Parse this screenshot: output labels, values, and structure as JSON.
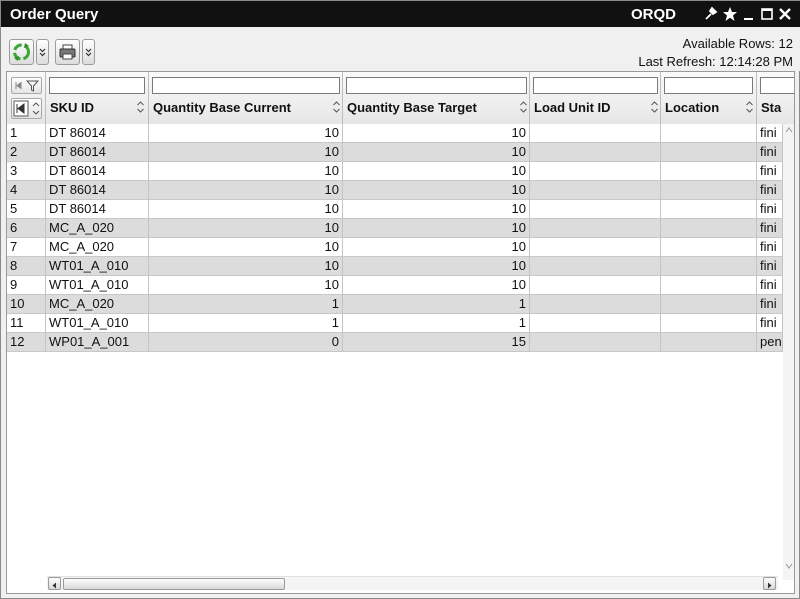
{
  "window": {
    "title": "Order Query",
    "code": "ORQD"
  },
  "status": {
    "available_rows": "Available Rows: 12",
    "last_refresh": "Last Refresh: 12:14:28 PM"
  },
  "columns": [
    {
      "key": "rownum",
      "label": ""
    },
    {
      "key": "sku",
      "label": "SKU ID"
    },
    {
      "key": "qbc",
      "label": "Quantity Base Current"
    },
    {
      "key": "qbt",
      "label": "Quantity Base Target"
    },
    {
      "key": "lu",
      "label": "Load Unit ID"
    },
    {
      "key": "loc",
      "label": "Location"
    },
    {
      "key": "status",
      "label": "Sta"
    }
  ],
  "rows": [
    {
      "n": "1",
      "sku": "DT 86014",
      "qbc": "10",
      "qbt": "10",
      "lu": "",
      "loc": "",
      "status": "fini"
    },
    {
      "n": "2",
      "sku": "DT 86014",
      "qbc": "10",
      "qbt": "10",
      "lu": "",
      "loc": "",
      "status": "fini"
    },
    {
      "n": "3",
      "sku": "DT 86014",
      "qbc": "10",
      "qbt": "10",
      "lu": "",
      "loc": "",
      "status": "fini"
    },
    {
      "n": "4",
      "sku": "DT 86014",
      "qbc": "10",
      "qbt": "10",
      "lu": "",
      "loc": "",
      "status": "fini"
    },
    {
      "n": "5",
      "sku": "DT 86014",
      "qbc": "10",
      "qbt": "10",
      "lu": "",
      "loc": "",
      "status": "fini"
    },
    {
      "n": "6",
      "sku": "MC_A_020",
      "qbc": "10",
      "qbt": "10",
      "lu": "",
      "loc": "",
      "status": "fini"
    },
    {
      "n": "7",
      "sku": "MC_A_020",
      "qbc": "10",
      "qbt": "10",
      "lu": "",
      "loc": "",
      "status": "fini"
    },
    {
      "n": "8",
      "sku": "WT01_A_010",
      "qbc": "10",
      "qbt": "10",
      "lu": "",
      "loc": "",
      "status": "fini"
    },
    {
      "n": "9",
      "sku": "WT01_A_010",
      "qbc": "10",
      "qbt": "10",
      "lu": "",
      "loc": "",
      "status": "fini"
    },
    {
      "n": "10",
      "sku": "MC_A_020",
      "qbc": "1",
      "qbt": "1",
      "lu": "",
      "loc": "",
      "status": "fini"
    },
    {
      "n": "11",
      "sku": "WT01_A_010",
      "qbc": "1",
      "qbt": "1",
      "lu": "",
      "loc": "",
      "status": "fini"
    },
    {
      "n": "12",
      "sku": "WP01_A_001",
      "qbc": "0",
      "qbt": "15",
      "lu": "",
      "loc": "",
      "status": "pen"
    }
  ],
  "icons": {
    "pin": "pin-icon",
    "favorite": "star-icon",
    "minimize": "minimize-icon",
    "maximize": "maximize-icon",
    "close": "close-icon",
    "refresh": "refresh-icon",
    "print": "printer-icon"
  },
  "colors": {
    "titlebar": "#111111",
    "alt_row": "#dcdcdc",
    "refresh_green": "#3aa635"
  }
}
